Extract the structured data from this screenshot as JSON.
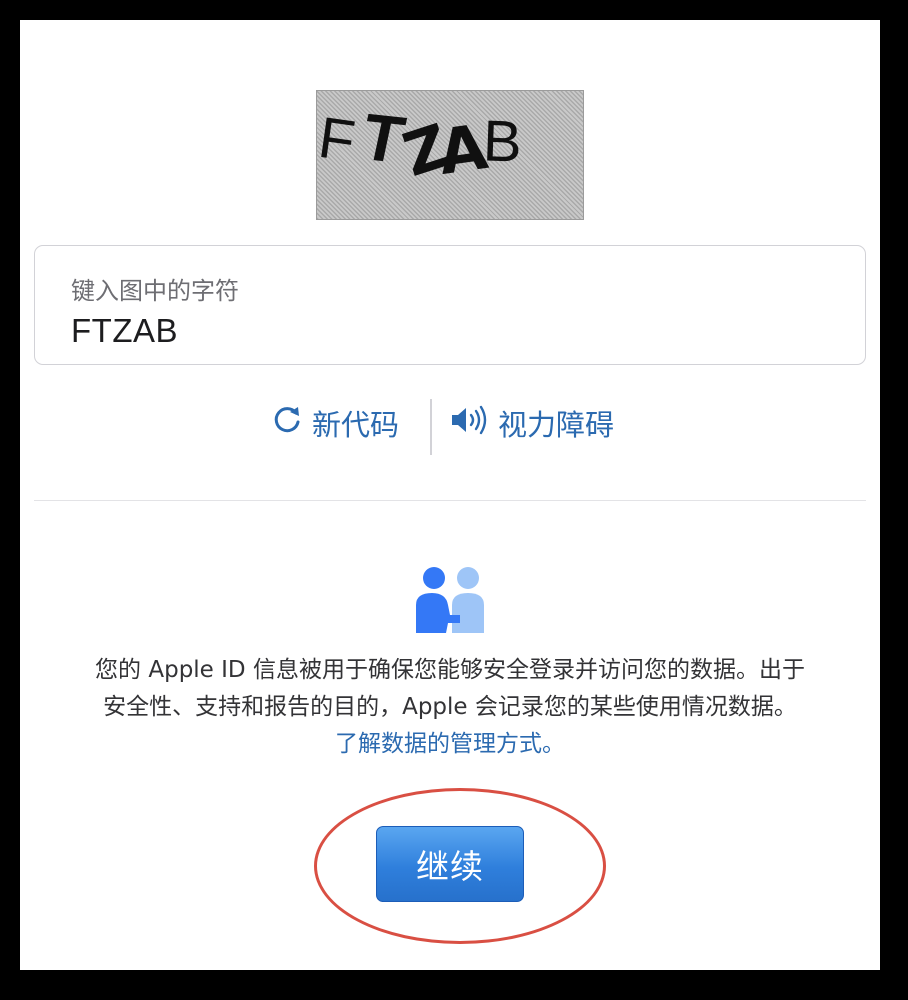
{
  "captcha": {
    "characters": [
      "F",
      "T",
      "Z",
      "A",
      "B"
    ]
  },
  "input": {
    "label": "键入图中的字符",
    "value": "FTZAB"
  },
  "actions": {
    "new_code": "新代码",
    "new_code_icon": "refresh-icon",
    "accessibility": "视力障碍",
    "accessibility_icon": "speaker-icon"
  },
  "privacy": {
    "icon": "people-handshake-icon",
    "line1": "您的 Apple ID 信息被用于确保您能够安全登录并访问您的数据。出于",
    "line2": "安全性、支持和报告的目的，Apple 会记录您的某些使用情况数据。",
    "link": "了解数据的管理方式。"
  },
  "continue_button": {
    "label": "继续",
    "color": "#2f7fdc"
  },
  "annotation": {
    "shape": "ellipse",
    "color": "#d94f43"
  },
  "colors": {
    "link": "#2b6ab0",
    "people_primary": "#3478f6",
    "people_secondary": "#9ec5f7"
  }
}
